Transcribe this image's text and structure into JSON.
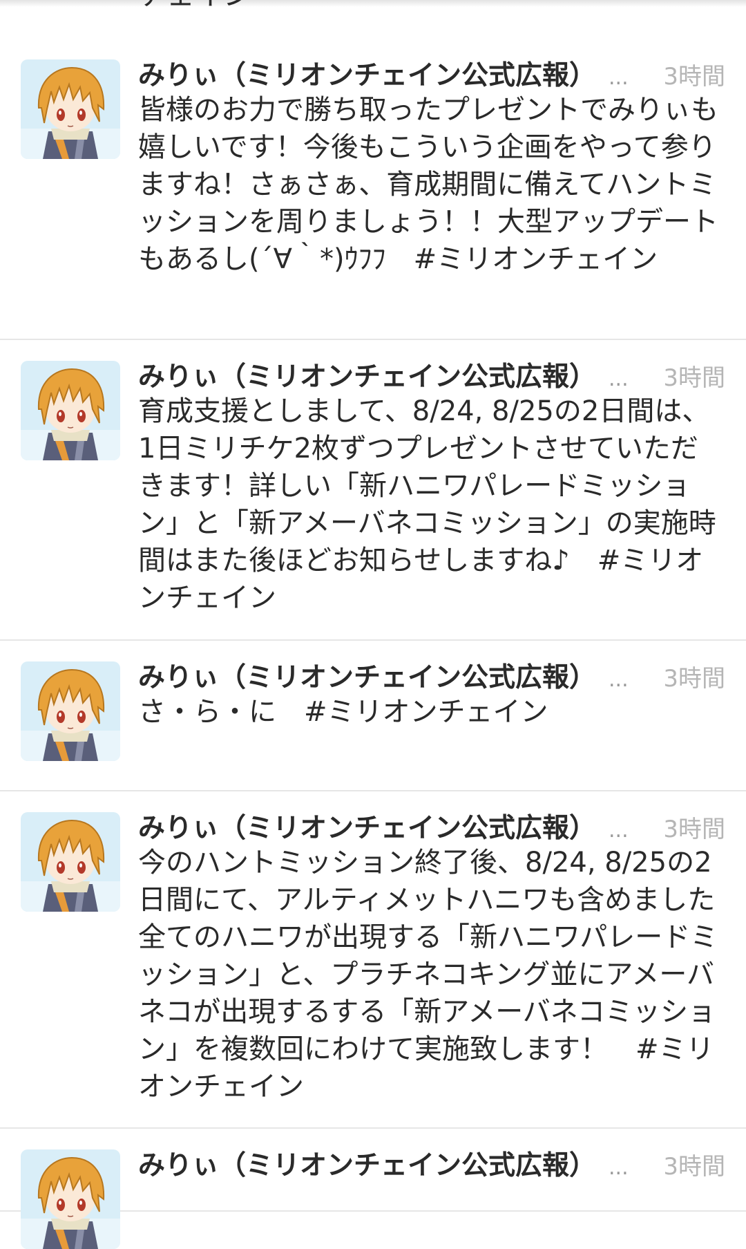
{
  "top_fragment": {
    "text": "チェイン"
  },
  "tweets": [
    {
      "name": "みりぃ（ミリオンチェイン公式広報）",
      "ellipsis": "...",
      "time": "3時間",
      "avatar_icon": "character-avatar-icon",
      "text": "皆様のお力で勝ち取ったプレゼントでみりぃも嬉しいです！今後もこういう企画をやって参りますね！さぁさぁ、育成期間に備えてハントミッションを周りましょう！！大型アップデートもあるし(´∀｀*)ｳﾌﾌ　#ミリオンチェイン"
    },
    {
      "name": "みりぃ（ミリオンチェイン公式広報）",
      "ellipsis": "...",
      "time": "3時間",
      "avatar_icon": "character-avatar-icon",
      "text": "育成支援としまして、8/24, 8/25の2日間は、1日ミリチケ2枚ずつプレゼントさせていただきます！詳しい「新ハニワパレードミッション」と「新アメーバネコミッション」の実施時間はまた後ほどお知らせしますね♪　#ミリオンチェイン"
    },
    {
      "name": "みりぃ（ミリオンチェイン公式広報）",
      "ellipsis": "...",
      "time": "3時間",
      "avatar_icon": "character-avatar-icon",
      "text": "さ・ら・に　#ミリオンチェイン"
    },
    {
      "name": "みりぃ（ミリオンチェイン公式広報）",
      "ellipsis": "...",
      "time": "3時間",
      "avatar_icon": "character-avatar-icon",
      "text": "今のハントミッション終了後、8/24, 8/25の2日間にて、アルティメットハニワも含めました全てのハニワが出現する「新ハニワパレードミッション」と、プラチネコキング並にアメーバネコが出現するする「新アメーバネコミッション」を複数回にわけて実施致します！　#ミリオンチェイン"
    },
    {
      "name": "みりぃ（ミリオンチェイン公式広報）",
      "ellipsis": "...",
      "time": "3時間",
      "avatar_icon": "character-avatar-icon",
      "text": ""
    }
  ],
  "colors": {
    "divider": "#e6e6e6",
    "name_text": "#2a2a2a",
    "time_text": "#b5b5b5",
    "avatar_hair": "#e8a23a",
    "avatar_bg": "#d6ecf7"
  }
}
